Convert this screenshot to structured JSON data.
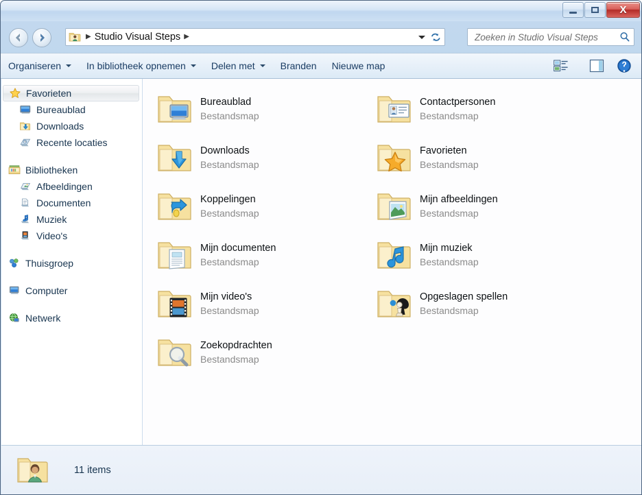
{
  "window": {
    "title": "",
    "controls": {
      "minimize_label": "—",
      "maximize_label": "□",
      "close_label": "X"
    }
  },
  "address": {
    "back_icon": "back-arrow-icon",
    "forward_icon": "forward-arrow-icon",
    "breadcrumb_icon": "user-folder-icon",
    "crumb_root_sep": "▶",
    "crumb_text": "Studio Visual Steps",
    "crumb_trailing_sep": "▶",
    "history_dropdown_icon": "chevron-down-icon",
    "refresh_icon": "refresh-icon"
  },
  "search": {
    "placeholder": "Zoeken in Studio Visual Steps",
    "value": "",
    "icon": "search-icon"
  },
  "toolbar": {
    "items": [
      {
        "label": "Organiseren",
        "has_caret": true
      },
      {
        "label": "In bibliotheek opnemen",
        "has_caret": true
      },
      {
        "label": "Delen met",
        "has_caret": true
      },
      {
        "label": "Branden",
        "has_caret": false
      },
      {
        "label": "Nieuwe map",
        "has_caret": false
      }
    ],
    "view_icon": "view-layout-icon",
    "view_caret_icon": "chevron-down-icon",
    "preview_pane_icon": "preview-pane-icon",
    "help_icon": "help-question-icon"
  },
  "sidebar": {
    "groups": [
      {
        "header": {
          "label": "Favorieten",
          "icon": "star-icon",
          "selected": true
        },
        "items": [
          {
            "label": "Bureaublad",
            "icon": "desktop-icon"
          },
          {
            "label": "Downloads",
            "icon": "downloads-folder-icon"
          },
          {
            "label": "Recente locaties",
            "icon": "recent-locations-icon"
          }
        ]
      },
      {
        "header": {
          "label": "Bibliotheken",
          "icon": "libraries-icon",
          "selected": false
        },
        "items": [
          {
            "label": "Afbeeldingen",
            "icon": "pictures-library-icon"
          },
          {
            "label": "Documenten",
            "icon": "documents-library-icon"
          },
          {
            "label": "Muziek",
            "icon": "music-library-icon"
          },
          {
            "label": "Video's",
            "icon": "videos-library-icon"
          }
        ]
      },
      {
        "header": {
          "label": "Thuisgroep",
          "icon": "homegroup-icon",
          "selected": false
        },
        "items": []
      },
      {
        "header": {
          "label": "Computer",
          "icon": "computer-icon",
          "selected": false
        },
        "items": []
      },
      {
        "header": {
          "label": "Netwerk",
          "icon": "network-icon",
          "selected": false
        },
        "items": []
      }
    ]
  },
  "files": {
    "type_label": "Bestandsmap",
    "items": [
      {
        "name": "Bureaublad",
        "type": "Bestandsmap",
        "icon": "folder-desktop-icon"
      },
      {
        "name": "Contactpersonen",
        "type": "Bestandsmap",
        "icon": "folder-contacts-icon"
      },
      {
        "name": "Downloads",
        "type": "Bestandsmap",
        "icon": "folder-downloads-icon"
      },
      {
        "name": "Favorieten",
        "type": "Bestandsmap",
        "icon": "folder-favorites-icon"
      },
      {
        "name": "Koppelingen",
        "type": "Bestandsmap",
        "icon": "folder-links-icon"
      },
      {
        "name": "Mijn afbeeldingen",
        "type": "Bestandsmap",
        "icon": "folder-pictures-icon"
      },
      {
        "name": "Mijn documenten",
        "type": "Bestandsmap",
        "icon": "folder-documents-icon"
      },
      {
        "name": "Mijn muziek",
        "type": "Bestandsmap",
        "icon": "folder-music-icon"
      },
      {
        "name": "Mijn video's",
        "type": "Bestandsmap",
        "icon": "folder-videos-icon"
      },
      {
        "name": "Opgeslagen spellen",
        "type": "Bestandsmap",
        "icon": "folder-savedgames-icon"
      },
      {
        "name": "Zoekopdrachten",
        "type": "Bestandsmap",
        "icon": "folder-searches-icon"
      }
    ]
  },
  "status": {
    "icon": "user-folder-icon",
    "text": "11 items"
  },
  "colors": {
    "accent_blue": "#1a3c63",
    "folder_yellow": "#f5dd9a",
    "close_red": "#b32b27",
    "muted_text": "#8a8a8a"
  }
}
